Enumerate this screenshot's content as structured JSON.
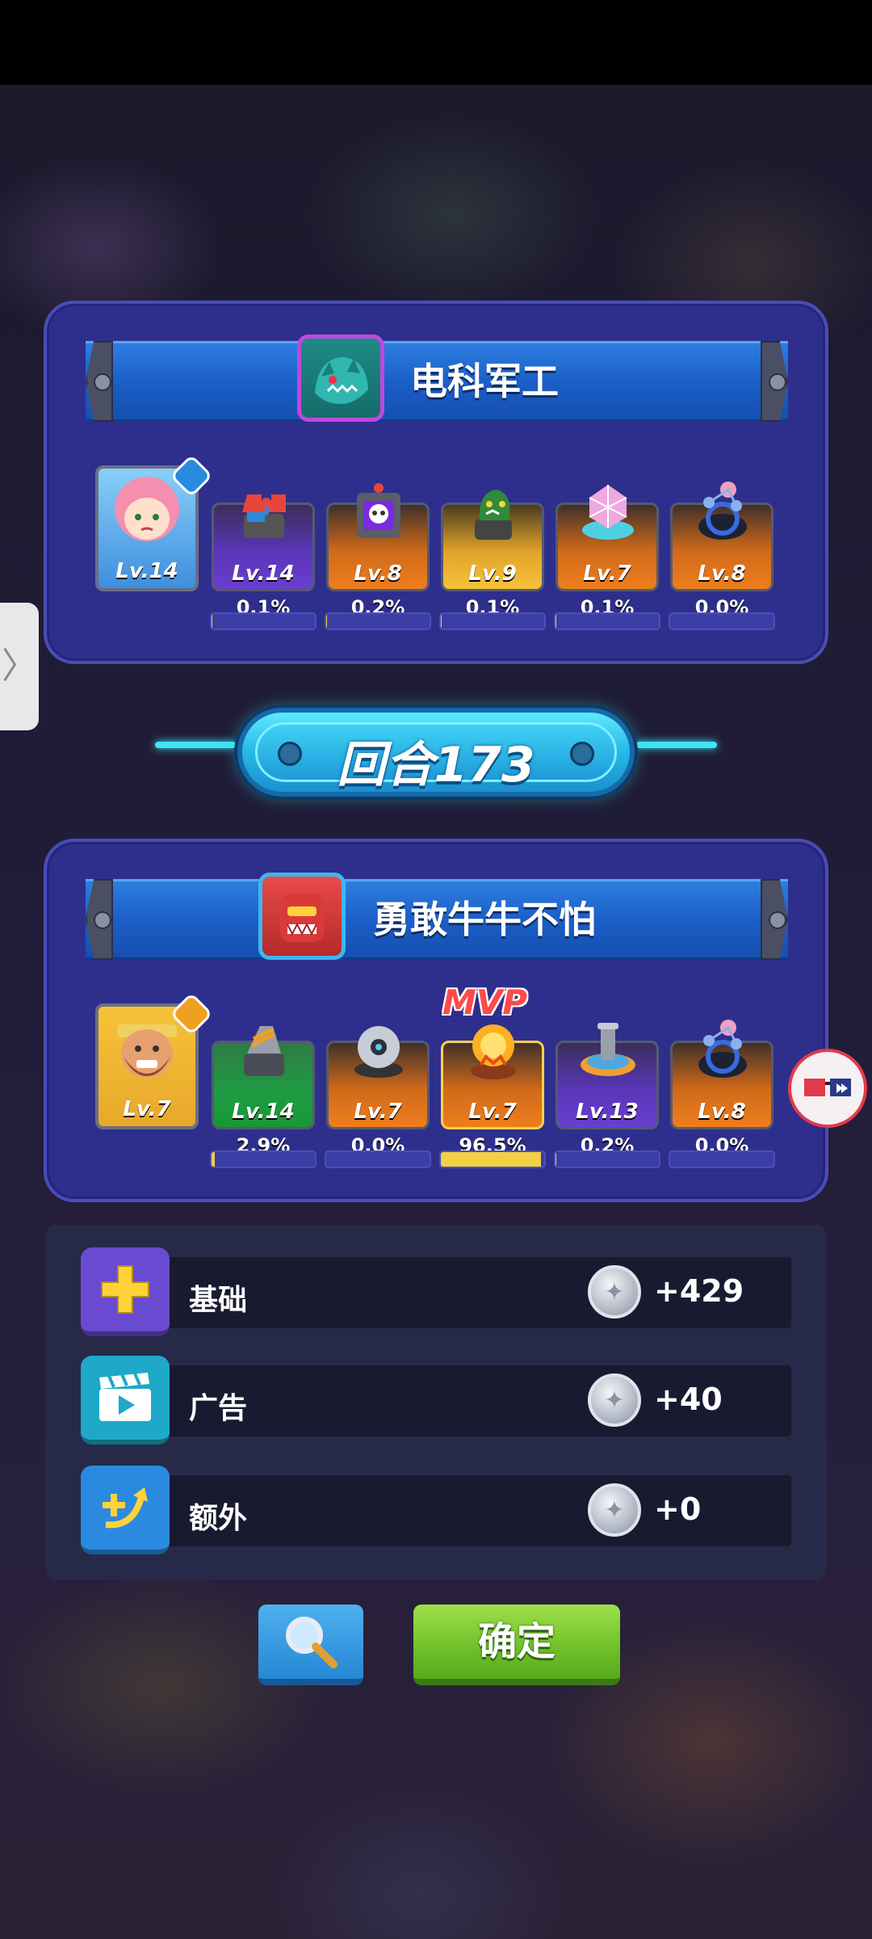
{
  "top_team": {
    "name": "电科军工",
    "avatar_icon": "teal-monster-avatar",
    "hero": {
      "level": "Lv.14",
      "icon": "pink-hair-girl-hero"
    },
    "cards": [
      {
        "level": "Lv.14",
        "percent": "0.1%",
        "share": 0.001,
        "rarity": "purple",
        "icon": "puzzle-tower-icon"
      },
      {
        "level": "Lv.8",
        "percent": "0.2%",
        "share": 0.002,
        "rarity": "orange",
        "icon": "skull-tower-icon"
      },
      {
        "level": "Lv.9",
        "percent": "0.1%",
        "share": 0.001,
        "rarity": "yellow",
        "icon": "snake-tower-icon"
      },
      {
        "level": "Lv.7",
        "percent": "0.1%",
        "share": 0.001,
        "rarity": "orange",
        "icon": "crystal-tower-icon"
      },
      {
        "level": "Lv.8",
        "percent": "0.0%",
        "share": 0.0,
        "rarity": "orange",
        "icon": "orbit-tower-icon"
      }
    ]
  },
  "round": {
    "label": "回合173"
  },
  "bottom_team": {
    "name": "勇敢牛牛不怕",
    "avatar_icon": "red-robot-avatar",
    "mvp_label": "MVP",
    "hero": {
      "level": "Lv.7",
      "icon": "bearded-fighter-hero"
    },
    "cards": [
      {
        "level": "Lv.14",
        "percent": "2.9%",
        "share": 0.029,
        "rarity": "green",
        "icon": "drill-tower-icon"
      },
      {
        "level": "Lv.7",
        "percent": "0.0%",
        "share": 0.0,
        "rarity": "orange",
        "icon": "robot-ball-tower-icon"
      },
      {
        "level": "Lv.7",
        "percent": "96.5%",
        "share": 0.965,
        "rarity": "orange",
        "icon": "fire-orb-tower-icon"
      },
      {
        "level": "Lv.13",
        "percent": "0.2%",
        "share": 0.002,
        "rarity": "purple",
        "icon": "cannon-tower-icon"
      },
      {
        "level": "Lv.8",
        "percent": "0.0%",
        "share": 0.0,
        "rarity": "orange",
        "icon": "orbit-tower-icon"
      }
    ]
  },
  "rewards": [
    {
      "label": "基础",
      "value": "+429",
      "icon": "plus-icon"
    },
    {
      "label": "广告",
      "value": "+40",
      "icon": "video-ad-icon"
    },
    {
      "label": "额外",
      "value": "+0",
      "icon": "bonus-arrow-icon"
    }
  ],
  "buttons": {
    "confirm": "确定",
    "search_icon": "magnifier-icon"
  },
  "colors": {
    "green": "#1f9b44",
    "orange": "#ee7e1c",
    "purple": "#6a3ed0",
    "yellow": "#f7c23a",
    "accent_cyan": "#3ce6f5",
    "panel": "#2e2f8c",
    "confirm_green": "#6fc02a"
  }
}
